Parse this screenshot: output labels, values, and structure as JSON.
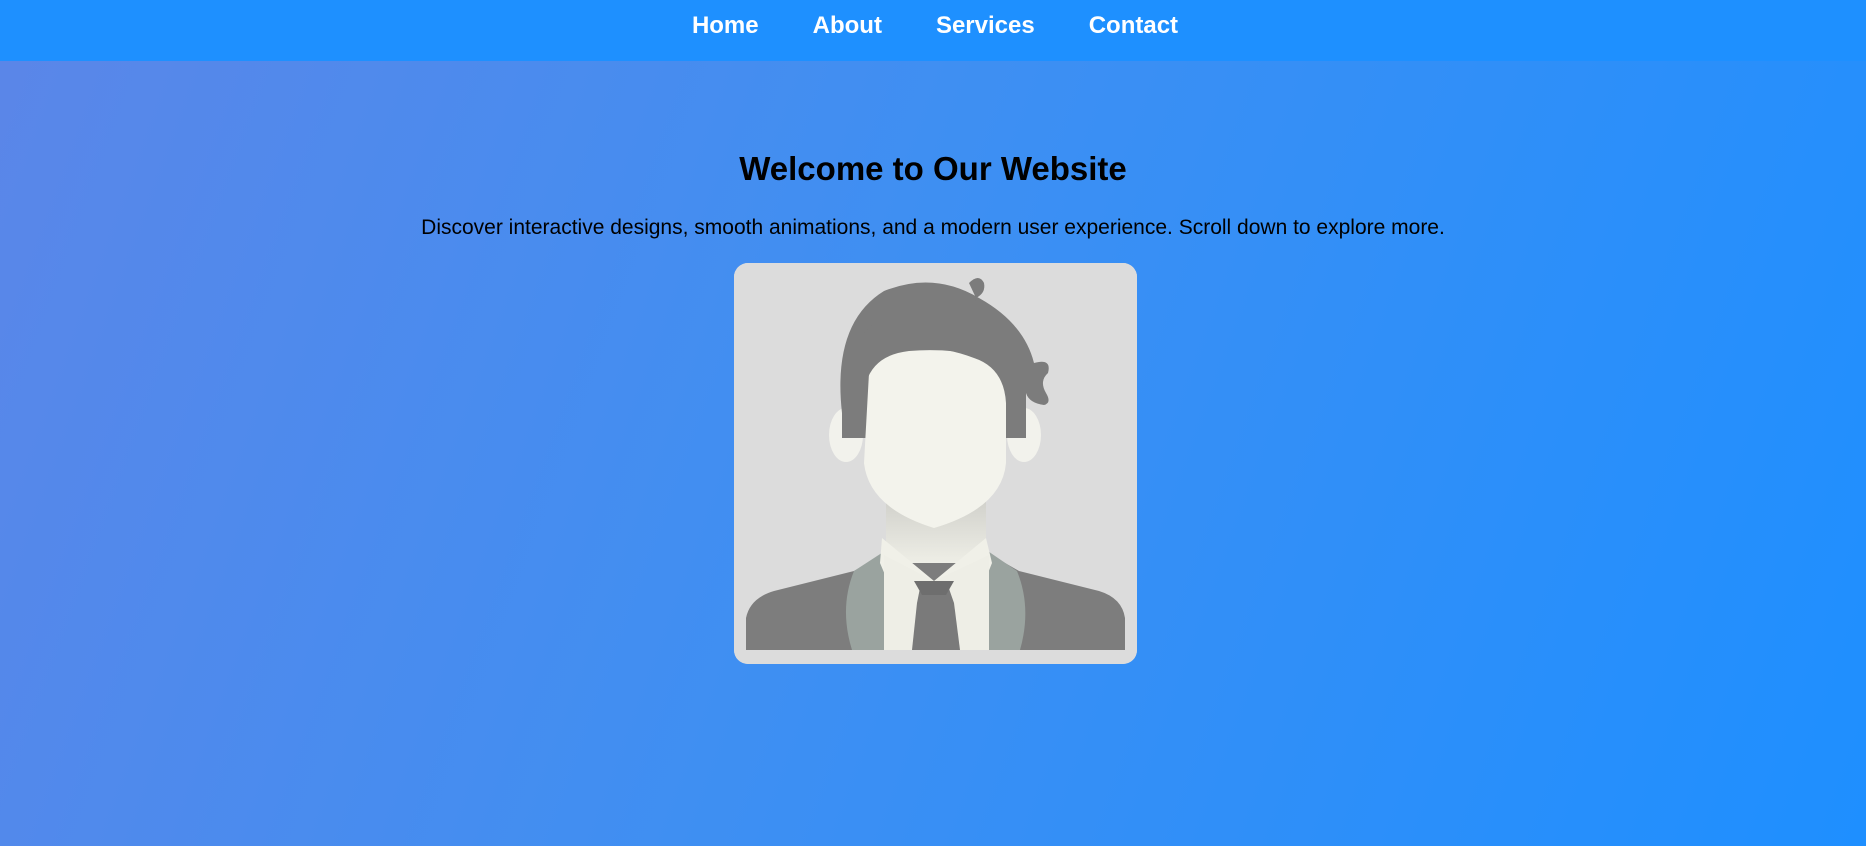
{
  "nav": {
    "items": [
      {
        "label": "Home"
      },
      {
        "label": "About"
      },
      {
        "label": "Services"
      },
      {
        "label": "Contact"
      }
    ]
  },
  "hero": {
    "title": "Welcome to Our Website",
    "subtitle": "Discover interactive designs, smooth animations, and a modern user experience. Scroll down to explore more."
  },
  "avatar": {
    "icon": "user-avatar-placeholder"
  },
  "colors": {
    "nav_bg": "#1e90ff",
    "gradient_start": "#5b86e8",
    "gradient_end": "#1e8fff",
    "text": "#000000",
    "nav_text": "#ffffff"
  }
}
